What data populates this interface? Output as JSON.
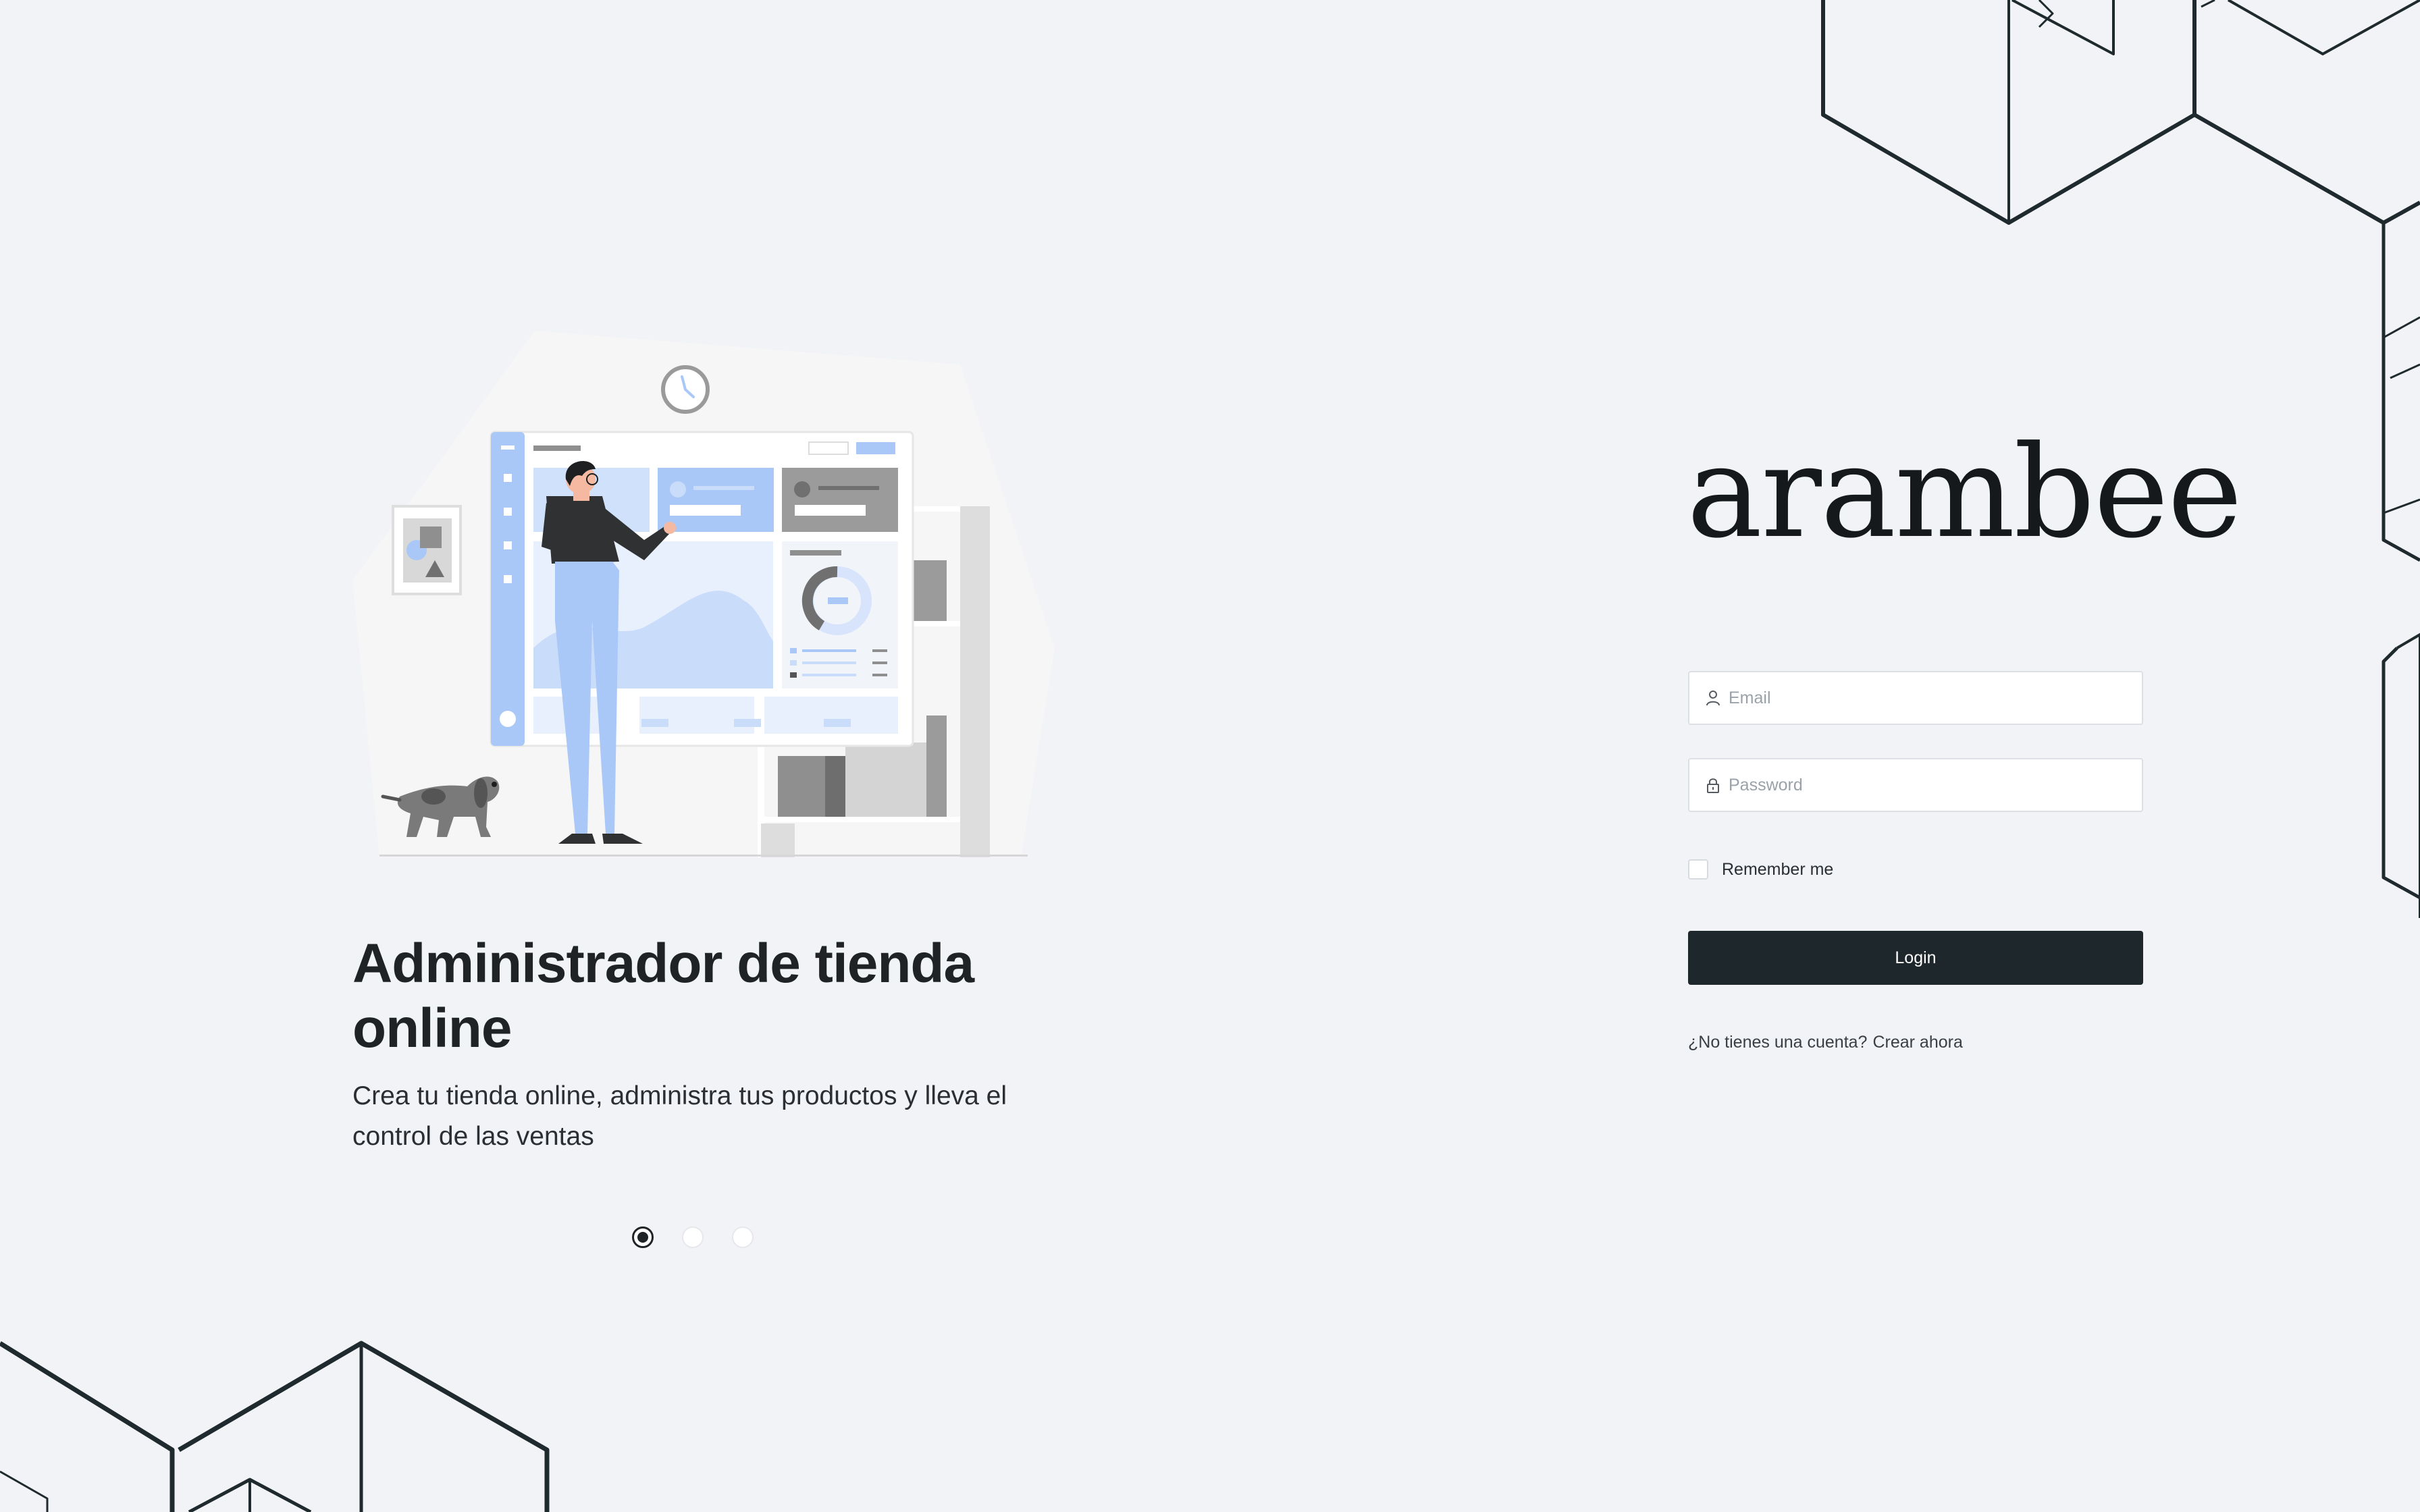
{
  "brand": {
    "logo_text": "arambee"
  },
  "hero": {
    "title": "Administrador de tienda online",
    "subtitle": "Crea tu tienda online, administra tus productos y lleva el control de las ventas"
  },
  "carousel": {
    "slide_count": 3,
    "active_index": 0
  },
  "login_form": {
    "email_placeholder": "Email",
    "password_placeholder": "Password",
    "remember_label": "Remember me",
    "login_label": "Login",
    "signup_prompt": "¿No tienes una cuenta?",
    "signup_link": "Crear ahora"
  },
  "colors": {
    "background": "#f1f3f6",
    "primary_button": "#1e272b",
    "illustration_accent": "#a9c8f7",
    "text_dark": "#1f2326"
  },
  "icons": {
    "email_field": "user-icon",
    "password_field": "lock-icon"
  }
}
